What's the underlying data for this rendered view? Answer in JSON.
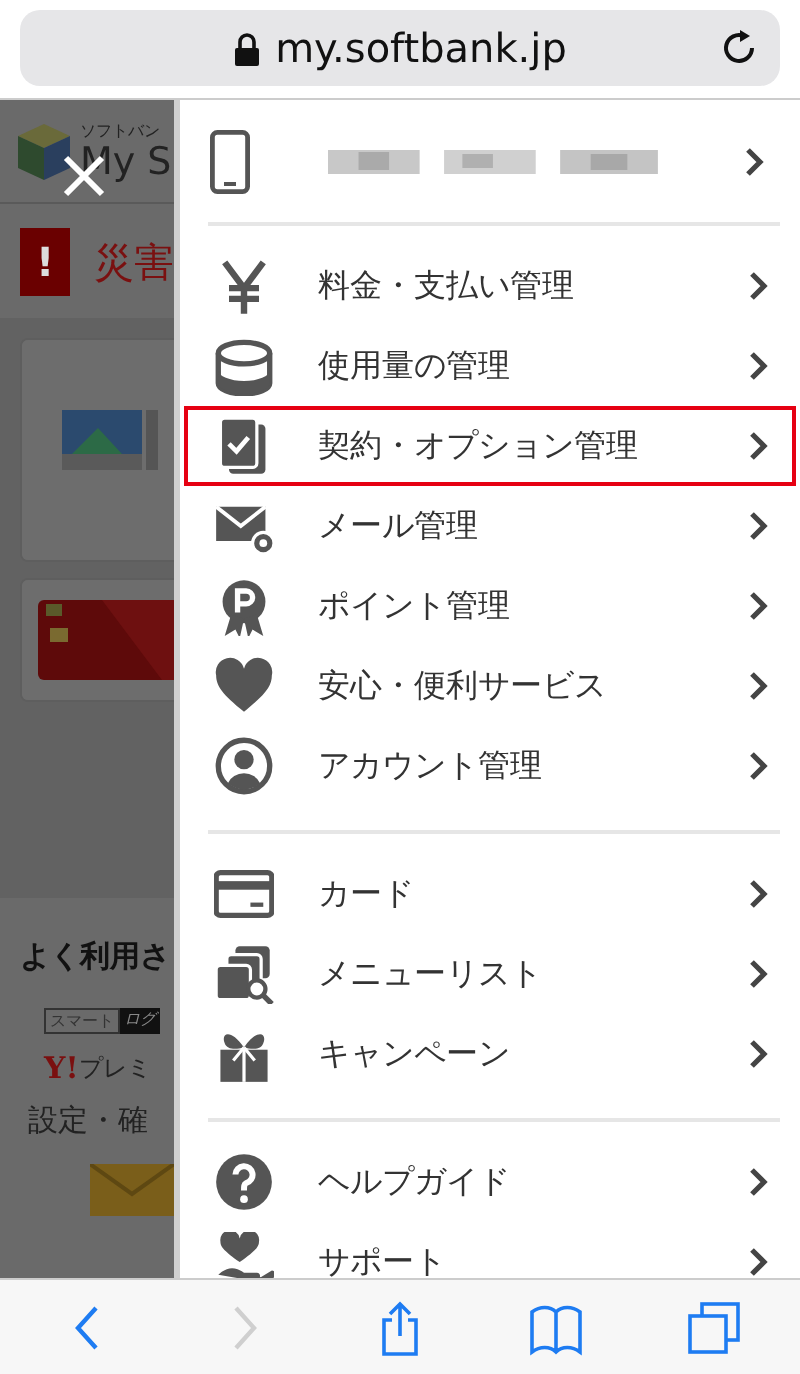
{
  "browser": {
    "url": "my.softbank.jp"
  },
  "background_page": {
    "logo_caption": "ソフトバン",
    "logo_title": "My S",
    "alert": {
      "icon": "!",
      "text": "災害"
    },
    "section_title": "よく利用さ",
    "smart_badge": [
      "スマート",
      "ログ"
    ],
    "premium": {
      "mark": "Y!",
      "text": "プレミ"
    },
    "settings": "設定・確"
  },
  "menu": {
    "account": {
      "kind": "phone"
    },
    "groups": [
      {
        "items": [
          {
            "kind": "yen",
            "label": "料金・支払い管理",
            "highlighted": false
          },
          {
            "kind": "usage",
            "label": "使用量の管理",
            "highlighted": false
          },
          {
            "kind": "contract",
            "label": "契約・オプション管理",
            "highlighted": true
          },
          {
            "kind": "mail",
            "label": "メール管理",
            "highlighted": false
          },
          {
            "kind": "point",
            "label": "ポイント管理",
            "highlighted": false
          },
          {
            "kind": "heart",
            "label": "安心・便利サービス",
            "highlighted": false
          },
          {
            "kind": "account",
            "label": "アカウント管理",
            "highlighted": false
          }
        ]
      },
      {
        "items": [
          {
            "kind": "card",
            "label": "カード",
            "highlighted": false
          },
          {
            "kind": "list",
            "label": "メニューリスト",
            "highlighted": false
          },
          {
            "kind": "gift",
            "label": "キャンペーン",
            "highlighted": false
          }
        ]
      },
      {
        "items": [
          {
            "kind": "help",
            "label": "ヘルプガイド",
            "highlighted": false
          },
          {
            "kind": "support",
            "label": "サポート",
            "highlighted": false
          }
        ]
      }
    ]
  },
  "toolbar": [
    {
      "kind": "back",
      "disabled": false
    },
    {
      "kind": "forward",
      "disabled": true
    },
    {
      "kind": "share",
      "disabled": false
    },
    {
      "kind": "bookmarks",
      "disabled": false
    },
    {
      "kind": "tabs",
      "disabled": false
    }
  ]
}
